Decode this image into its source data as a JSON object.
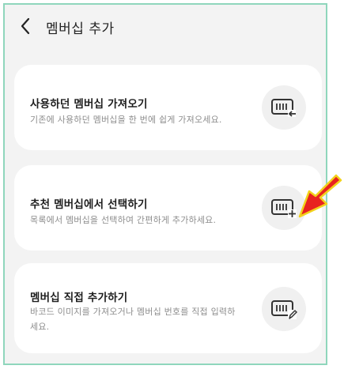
{
  "header": {
    "title": "멤버십 추가",
    "back_icon": "chevron-left-icon"
  },
  "options": [
    {
      "title": "사용하던 멤버십 가져오기",
      "description": "기존에 사용하던 멤버십을 한 번에 쉽게 가져오세요.",
      "icon": "barcode-import-icon"
    },
    {
      "title": "추천 멤버십에서 선택하기",
      "description": "목록에서 멤버십을 선택하여 간편하게 추가하세요.",
      "icon": "barcode-add-icon"
    },
    {
      "title": "멤버십 직접 추가하기",
      "description": "바코드 이미지를 가져오거나 멤버십 번호를 직접 입력하세요.",
      "icon": "barcode-edit-icon"
    }
  ],
  "colors": {
    "frame_border": "#8fd6bc",
    "background": "#f3f3f3",
    "card": "#ffffff",
    "annotation_arrow": "#e8231f",
    "annotation_outline": "#f2d21b"
  }
}
